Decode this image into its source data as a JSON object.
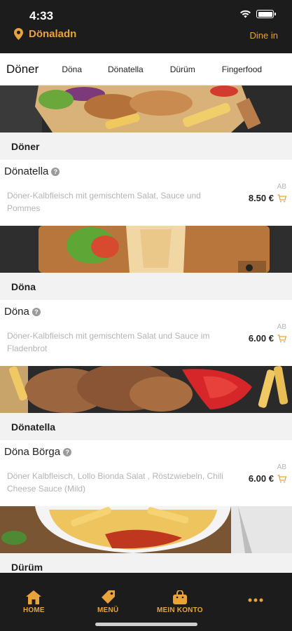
{
  "status_bar": {
    "time": "4:33"
  },
  "header": {
    "location_name": "Dönaladn",
    "dine_in": "Dine in"
  },
  "tabs": [
    {
      "label": "Döner",
      "active": true
    },
    {
      "label": "Döna",
      "active": false
    },
    {
      "label": "Dönatella",
      "active": false
    },
    {
      "label": "Dürüm",
      "active": false
    },
    {
      "label": "Fingerfood",
      "active": false
    }
  ],
  "sections": [
    {
      "title": "Döner",
      "item": {
        "name": "Dönatella",
        "description": "Döner-Kalbfleisch mit gemischtem Salat, Sauce und Pommes",
        "price_prefix": "AB",
        "price": "8.50 €"
      }
    },
    {
      "title": "Döna",
      "item": {
        "name": "Döna",
        "description": "Döner-Kalbfleisch mit gemischtem Salat und Sauce im Fladenbrot",
        "price_prefix": "AB",
        "price": "6.00 €"
      }
    },
    {
      "title": "Dönatella",
      "item": {
        "name": "Döna Börga",
        "description": "Döner Kalbfleisch, Lollo Bionda Salat , Röstzwiebeln, Chili Cheese Sauce (Mild)",
        "price_prefix": "AB",
        "price": "6.00 €"
      }
    },
    {
      "title": "Dürüm"
    }
  ],
  "bottom_nav": [
    {
      "label": "HOME",
      "icon": "home-icon"
    },
    {
      "label": "MENÜ",
      "icon": "tag-icon"
    },
    {
      "label": "MEIN KONTO",
      "icon": "bag-icon"
    },
    {
      "label": "",
      "icon": "more-icon"
    }
  ],
  "colors": {
    "accent": "#e8a33a",
    "header_bg": "#1c1c1c",
    "background": "#f2f2f2"
  }
}
